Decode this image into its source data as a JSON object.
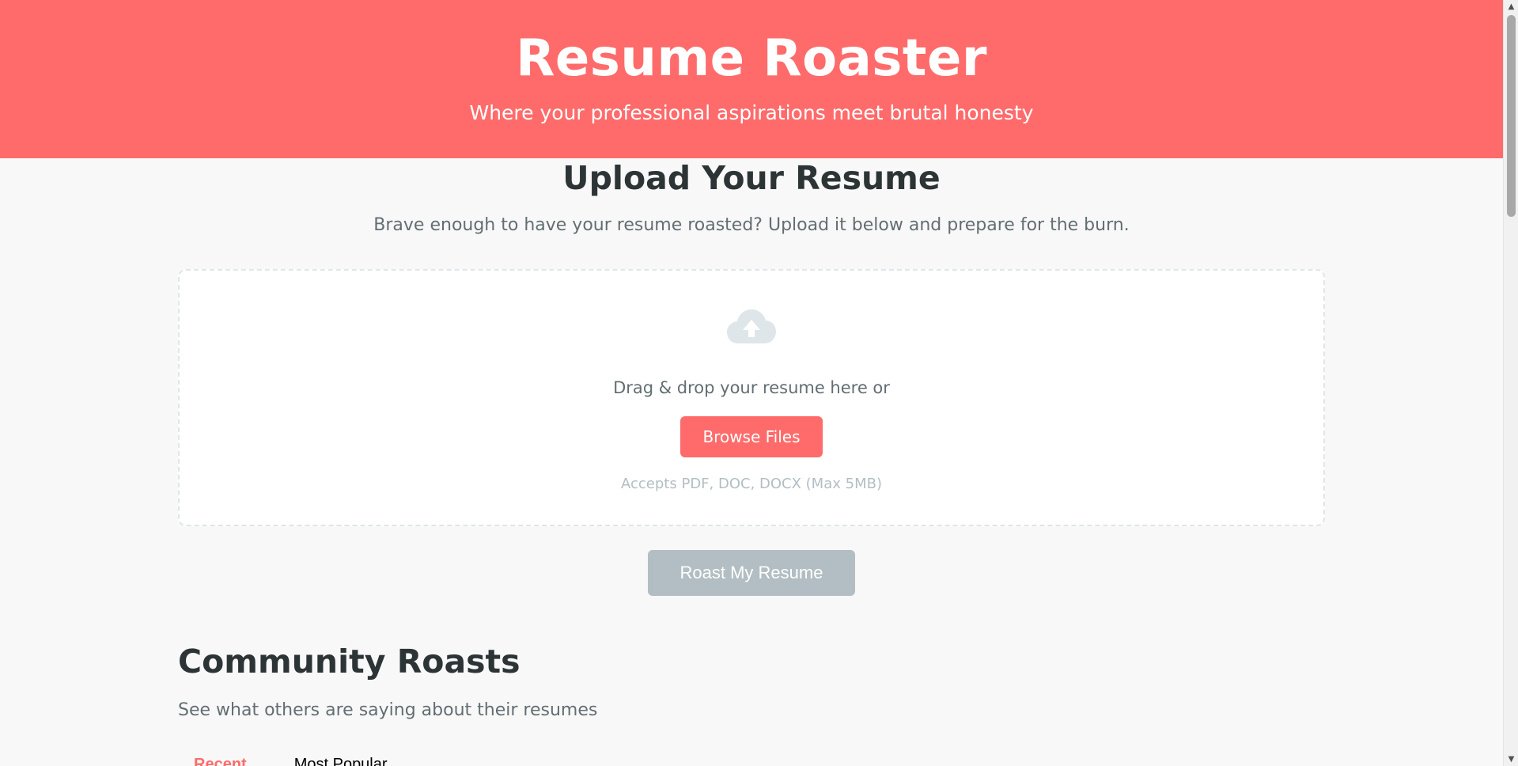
{
  "header": {
    "title": "Resume Roaster",
    "tagline": "Where your professional aspirations meet brutal honesty"
  },
  "upload": {
    "title": "Upload Your Resume",
    "description": "Brave enough to have your resume roasted? Upload it below and prepare for the burn.",
    "dropzone": {
      "icon": "cloud-upload-icon",
      "text": "Drag & drop your resume here or",
      "browse_label": "Browse Files",
      "note": "Accepts PDF, DOC, DOCX (Max 5MB)"
    },
    "roast_label": "Roast My Resume"
  },
  "community": {
    "title": "Community Roasts",
    "description": "See what others are saying about their resumes",
    "tabs": [
      {
        "label": "Recent",
        "active": true
      },
      {
        "label": "Most Popular",
        "active": false
      }
    ]
  },
  "colors": {
    "accent": "#ff6b6b",
    "disabled": "#b2bec3",
    "text_dark": "#2d3436",
    "text_muted": "#636e72"
  },
  "scrollbar": {
    "up_icon": "chevron-up-icon",
    "down_icon": "chevron-down-icon"
  }
}
